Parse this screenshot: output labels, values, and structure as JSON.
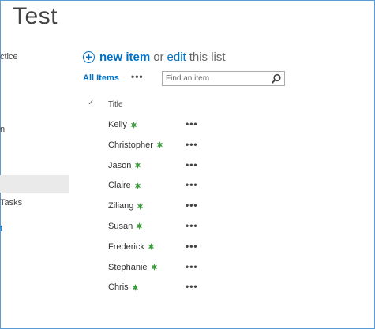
{
  "site": {
    "title": "Test"
  },
  "quicklaunch": {
    "item_1": "ctice",
    "item_2": "n",
    "item_3": "Tasks",
    "item_4": "t"
  },
  "command": {
    "new_item": "new item",
    "or": "or",
    "edit": "edit",
    "this_list": "this list"
  },
  "views": {
    "current": "All Items",
    "more": "•••"
  },
  "search": {
    "placeholder": "Find an item"
  },
  "list": {
    "columns": {
      "check": "✓",
      "title": "Title"
    },
    "row_menu": "•••",
    "rows": [
      "Kelly",
      "Christopher",
      "Jason",
      "Claire",
      "Ziliang",
      "Susan",
      "Frederick",
      "Stephanie",
      "Chris"
    ]
  },
  "colors": {
    "accent": "#0072c6",
    "new_badge": "#3a9c3a",
    "frame": "#5b9bd5"
  }
}
